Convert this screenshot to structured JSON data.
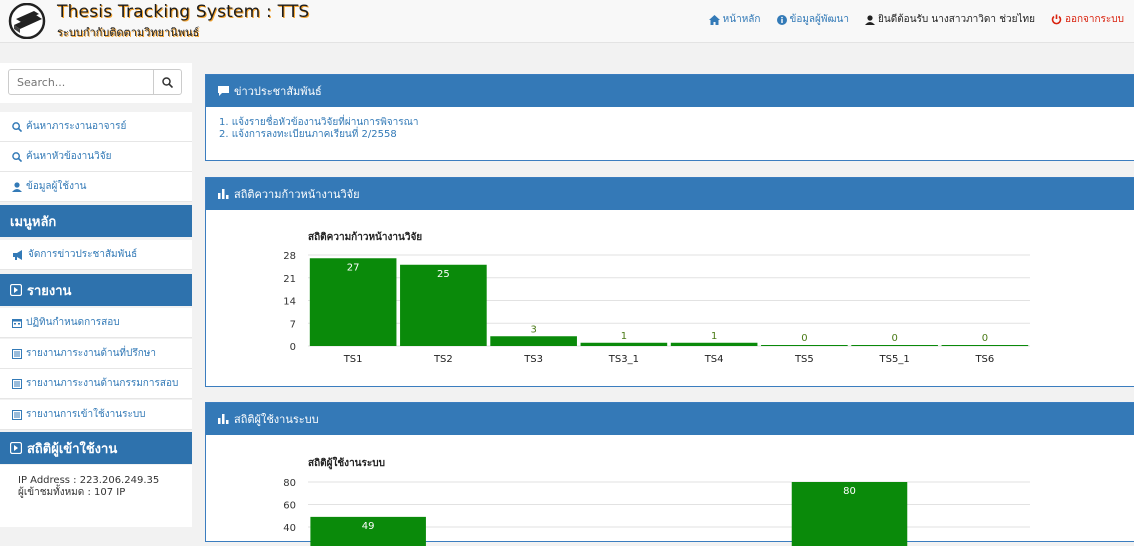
{
  "header": {
    "title": "Thesis Tracking System : TTS",
    "subtitle": "ระบบกำกับติดตามวิทยานิพนธ์",
    "nav": {
      "home": "หน้าหลัก",
      "developer": "ข้อมูลผู้พัฒนา",
      "welcome": "ยินดีต้อนรับ นางสาวภาวิดา ช่วยไทย",
      "logout": "ออกจากระบบ"
    }
  },
  "sidebar": {
    "search_placeholder": "Search...",
    "items": [
      {
        "label": "ค้นหาภาระงานอาจารย์",
        "icon": "search-icon"
      },
      {
        "label": "ค้นหาหัวข้องานวิจัย",
        "icon": "search-icon"
      },
      {
        "label": "ข้อมูลผู้ใช้งาน",
        "icon": "user-icon"
      }
    ],
    "main_menu_heading": "เมนูหลัก",
    "main_menu_items": [
      {
        "label": "จัดการข่าวประชาสัมพันธ์",
        "icon": "bullhorn-icon"
      }
    ],
    "report_heading": "รายงาน",
    "report_items": [
      {
        "label": "ปฏิทินกำหนดการสอบ",
        "icon": "calendar-icon"
      },
      {
        "label": "รายงานภาระงานด้านที่ปรึกษา",
        "icon": "list-icon"
      },
      {
        "label": "รายงานภาระงานด้านกรรมการสอบ",
        "icon": "list-icon"
      },
      {
        "label": "รายงานการเข้าใช้งานระบบ",
        "icon": "list-icon"
      }
    ],
    "visitor_heading": "สถิติผู้เข้าใช้งาน",
    "ip_address": "IP Address : 223.206.249.35",
    "total_visitors": "ผู้เข้าชมทั้งหมด : 107 IP"
  },
  "news_panel": {
    "heading": "ข่าวประชาสัมพันธ์",
    "items": [
      "1. แจ้งรายชื่อหัวข้องานวิจัยที่ผ่านการพิจารณา",
      "2. แจ้งการลงทะเบียนภาคเรียนที่ 2/2558"
    ]
  },
  "progress_panel": {
    "heading": "สถิติความก้าวหน้างานวิจัย"
  },
  "usage_panel": {
    "heading": "สถิติผู้ใช้งานระบบ"
  },
  "colors": {
    "bar": "#0a8a0a",
    "panel_header": "#3479b7",
    "sidebar_header": "#2e72ad"
  },
  "chart_data": [
    {
      "type": "bar",
      "title": "สถิติความก้าวหน้างานวิจัย",
      "categories": [
        "TS1",
        "TS2",
        "TS3",
        "TS3_1",
        "TS4",
        "TS5",
        "TS5_1",
        "TS6"
      ],
      "values": [
        27,
        25,
        3,
        1,
        1,
        0,
        0,
        0
      ],
      "ylim": [
        0,
        28
      ],
      "yticks": [
        0,
        7,
        14,
        21,
        28
      ],
      "grid": true
    },
    {
      "type": "bar",
      "title": "สถิติผู้ใช้งานระบบ",
      "categories": [
        "",
        "",
        "",
        "",
        "",
        ""
      ],
      "values": [
        49,
        null,
        null,
        null,
        80,
        null
      ],
      "ylim": [
        0,
        80
      ],
      "yticks": [
        40,
        60,
        80
      ],
      "grid": true
    }
  ]
}
